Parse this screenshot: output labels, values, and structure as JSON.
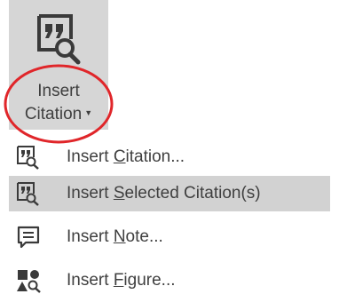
{
  "ribbon": {
    "button_label_line1": "Insert",
    "button_label_line2": "Citation",
    "icon": "quote-search-icon",
    "highlight_color": "#e0262a"
  },
  "menu": {
    "items": [
      {
        "pre": "Insert ",
        "key": "C",
        "post": "itation...",
        "icon": "quote-search-icon",
        "selected": false
      },
      {
        "pre": "Insert ",
        "key": "S",
        "post": "elected Citation(s)",
        "icon": "quote-search-icon",
        "selected": true
      },
      {
        "pre": "Insert ",
        "key": "N",
        "post": "ote...",
        "icon": "note-icon",
        "selected": false
      },
      {
        "pre": "Insert ",
        "key": "F",
        "post": "igure...",
        "icon": "figure-icon",
        "selected": false
      }
    ]
  },
  "colors": {
    "button_bg": "#d6d6d6",
    "selected_bg": "#d2d2d2",
    "text": "#3f3f3f"
  }
}
